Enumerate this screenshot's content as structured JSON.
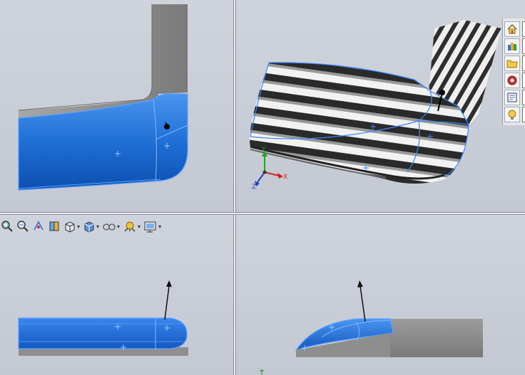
{
  "viewports": {
    "top_left": {
      "name": "front-view"
    },
    "top_right": {
      "name": "isometric-view"
    },
    "bottom_left": {
      "name": "top-view"
    },
    "bottom_right": {
      "name": "right-view"
    }
  },
  "triad": {
    "x_label": "X",
    "y_label": "Y",
    "z_label": "Z"
  },
  "colors": {
    "surface_blue": "#1f6fd6",
    "surface_edge": "#5aa2ff",
    "gray_body": "#8e8e8e",
    "background": "#c8ccd6"
  },
  "view_toolbar": {
    "items": [
      {
        "icon": "zoom-to-fit-icon"
      },
      {
        "icon": "zoom-to-area-icon"
      },
      {
        "icon": "previous-view-icon"
      },
      {
        "icon": "section-view-icon"
      },
      {
        "icon": "view-orientation-icon",
        "dropdown": true
      },
      {
        "icon": "display-style-icon",
        "dropdown": true
      },
      {
        "icon": "hide-show-items-icon",
        "dropdown": true
      },
      {
        "icon": "edit-appearance-icon",
        "dropdown": true
      },
      {
        "icon": "apply-scene-icon",
        "dropdown": true
      }
    ]
  },
  "task_pane": {
    "items": [
      {
        "icon": "home-icon"
      },
      {
        "icon": "design-library-icon"
      },
      {
        "icon": "file-explorer-icon"
      },
      {
        "icon": "view-palette-icon"
      },
      {
        "icon": "custom-properties-icon"
      },
      {
        "icon": "appearances-icon"
      }
    ]
  }
}
